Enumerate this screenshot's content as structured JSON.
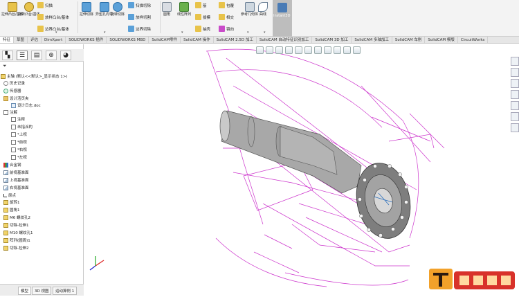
{
  "ribbon": {
    "groups": [
      {
        "label": "拉伸凸台/基体"
      },
      {
        "label": "旋转凸台/基体"
      },
      {
        "label": "扫描"
      },
      {
        "label": "放样凸台/基体"
      },
      {
        "label": "边界凸台/基体"
      },
      {
        "label": "拉伸切除"
      },
      {
        "label": "异型孔向导"
      },
      {
        "label": "旋转切除"
      },
      {
        "label": "扫描切除"
      },
      {
        "label": "放样切割"
      },
      {
        "label": "边界切除"
      },
      {
        "label": "圆角"
      },
      {
        "label": "线性阵列"
      },
      {
        "label": "筋"
      },
      {
        "label": "拔模"
      },
      {
        "label": "抽壳"
      },
      {
        "label": "包覆"
      },
      {
        "label": "相交"
      },
      {
        "label": "镜向"
      },
      {
        "label": "参考几何体"
      },
      {
        "label": "曲线"
      },
      {
        "label": "Instant3D"
      }
    ]
  },
  "tabs": [
    "特征",
    "草图",
    "评估",
    "DimXpert",
    "SOLIDWORKS 插件",
    "SOLIDWORKS MBD",
    "SolidCAM零件",
    "SolidCAM 操作",
    "SolidCAM 2.5D 加工",
    "SolidCAM 自动特征识别加工",
    "SolidCAM 3D 加工",
    "SolidCAM 多轴加工",
    "SolidCAM 车削",
    "SolidCAM 模版",
    "CircuitWorks"
  ],
  "active_tab": "特征",
  "tree": {
    "root": "主轴 (默认<<默认>_显示状态 1>)",
    "items": [
      "历史记录",
      "传感器",
      "设计活页夹",
      "设计日志.doc",
      "注解",
      "注释",
      "未指派的",
      "*上视",
      "*前视",
      "*右视",
      "*左视",
      "合金钢",
      "前视基准面",
      "上视基准面",
      "右视基准面",
      "原点",
      "旋转1",
      "圆角1",
      "M6 螺纹孔2",
      "切除-拉伸1",
      "M10 螺纹孔1",
      "阵列(圆周)1",
      "切除-拉伸2"
    ]
  },
  "model_tabs": [
    "模型",
    "3D 视图",
    "运动算例 1"
  ],
  "colors": {
    "sketch": "#cc33cc",
    "part": "#8e8e8e",
    "ribbon": "#f3f3f3",
    "accent": "#2a6ebb"
  }
}
